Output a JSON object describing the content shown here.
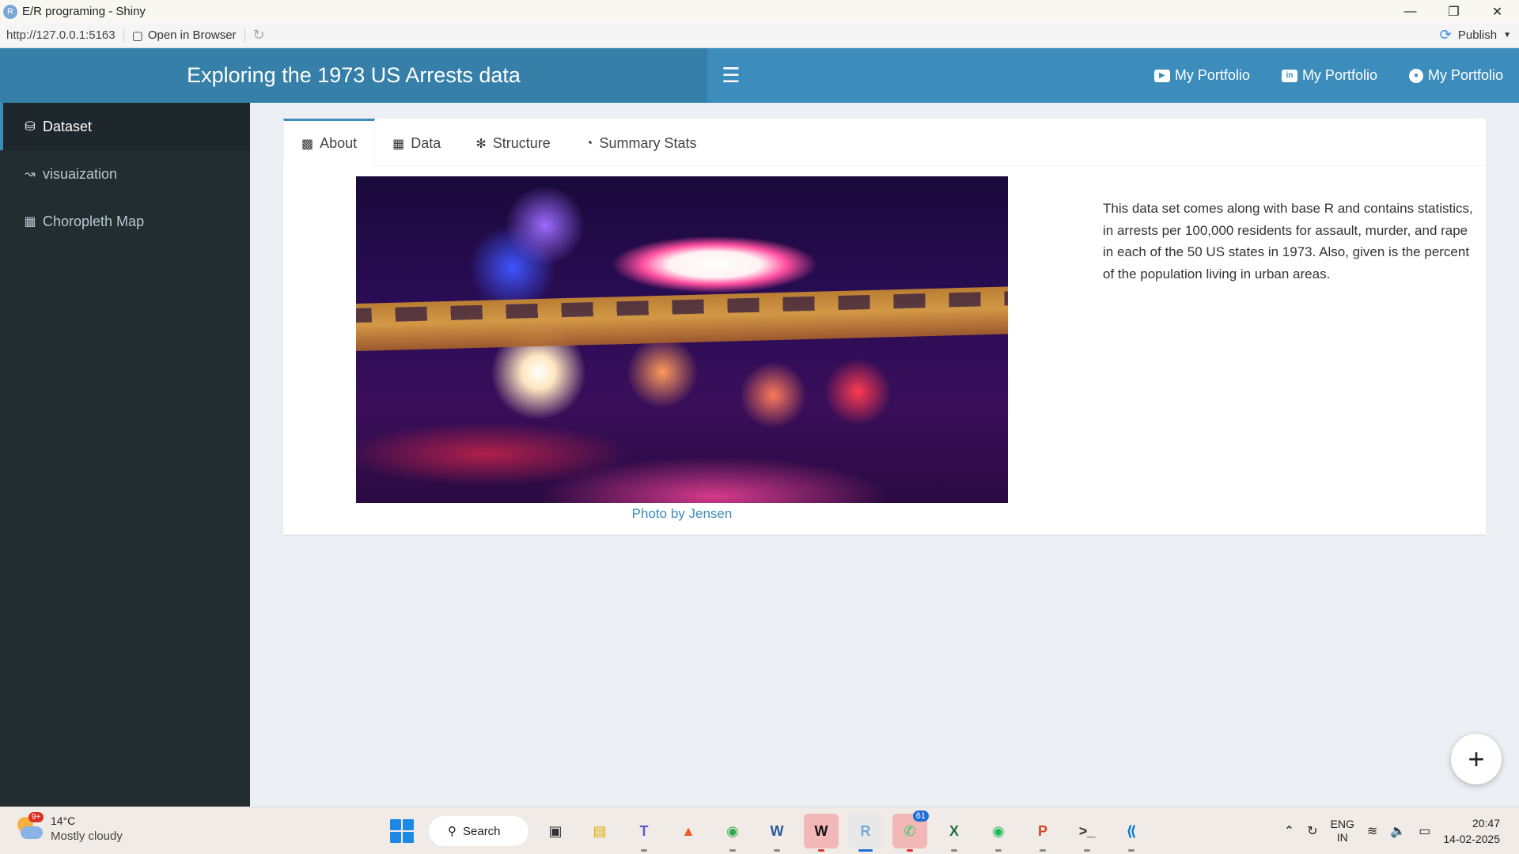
{
  "window": {
    "title": "E/R programing - Shiny",
    "icon": "r-logo-icon"
  },
  "viewer": {
    "url": "http://127.0.0.1:5163",
    "open_in_browser": "Open in Browser",
    "publish": "Publish"
  },
  "header": {
    "title": "Exploring the 1973 US Arrests data",
    "nav": [
      {
        "label": "My Portfolio",
        "icon": "youtube-icon"
      },
      {
        "label": "My Portfolio",
        "icon": "linkedin-icon"
      },
      {
        "label": "My Portfolio",
        "icon": "github-icon"
      }
    ]
  },
  "sidebar": {
    "items": [
      {
        "label": "Dataset",
        "icon": "database-icon",
        "active": true
      },
      {
        "label": "visuaization",
        "icon": "line-chart-icon",
        "active": false
      },
      {
        "label": "Choropleth Map",
        "icon": "map-icon",
        "active": false
      }
    ]
  },
  "tabs": [
    {
      "label": "About",
      "icon": "id-card-icon",
      "active": true
    },
    {
      "label": "Data",
      "icon": "table-icon",
      "active": false
    },
    {
      "label": "Structure",
      "icon": "project-diagram-icon",
      "active": false
    },
    {
      "label": "Summary Stats",
      "icon": "pie-chart-icon",
      "active": false
    }
  ],
  "about": {
    "caption": "Photo by Jensen",
    "description": "This data set comes along with base R and contains statistics, in arrests per 100,000 residents for assault, murder, and rape in each of the 50 US states in 1973. Also, given is the percent of the population living in urban areas."
  },
  "fab": "+",
  "taskbar": {
    "weather_temp": "14°C",
    "weather_cond": "Mostly cloudy",
    "weather_badge": "9+",
    "search": "Search",
    "whatsapp_badge": "61",
    "lang_top": "ENG",
    "lang_bottom": "IN",
    "time": "20:47",
    "date": "14-02-2025"
  },
  "colors": {
    "header": "#3c8dbc",
    "header_logo": "#367fa9",
    "sidebar": "#222d32",
    "content_bg": "#ecf0f5",
    "link": "#3c8dbc"
  }
}
